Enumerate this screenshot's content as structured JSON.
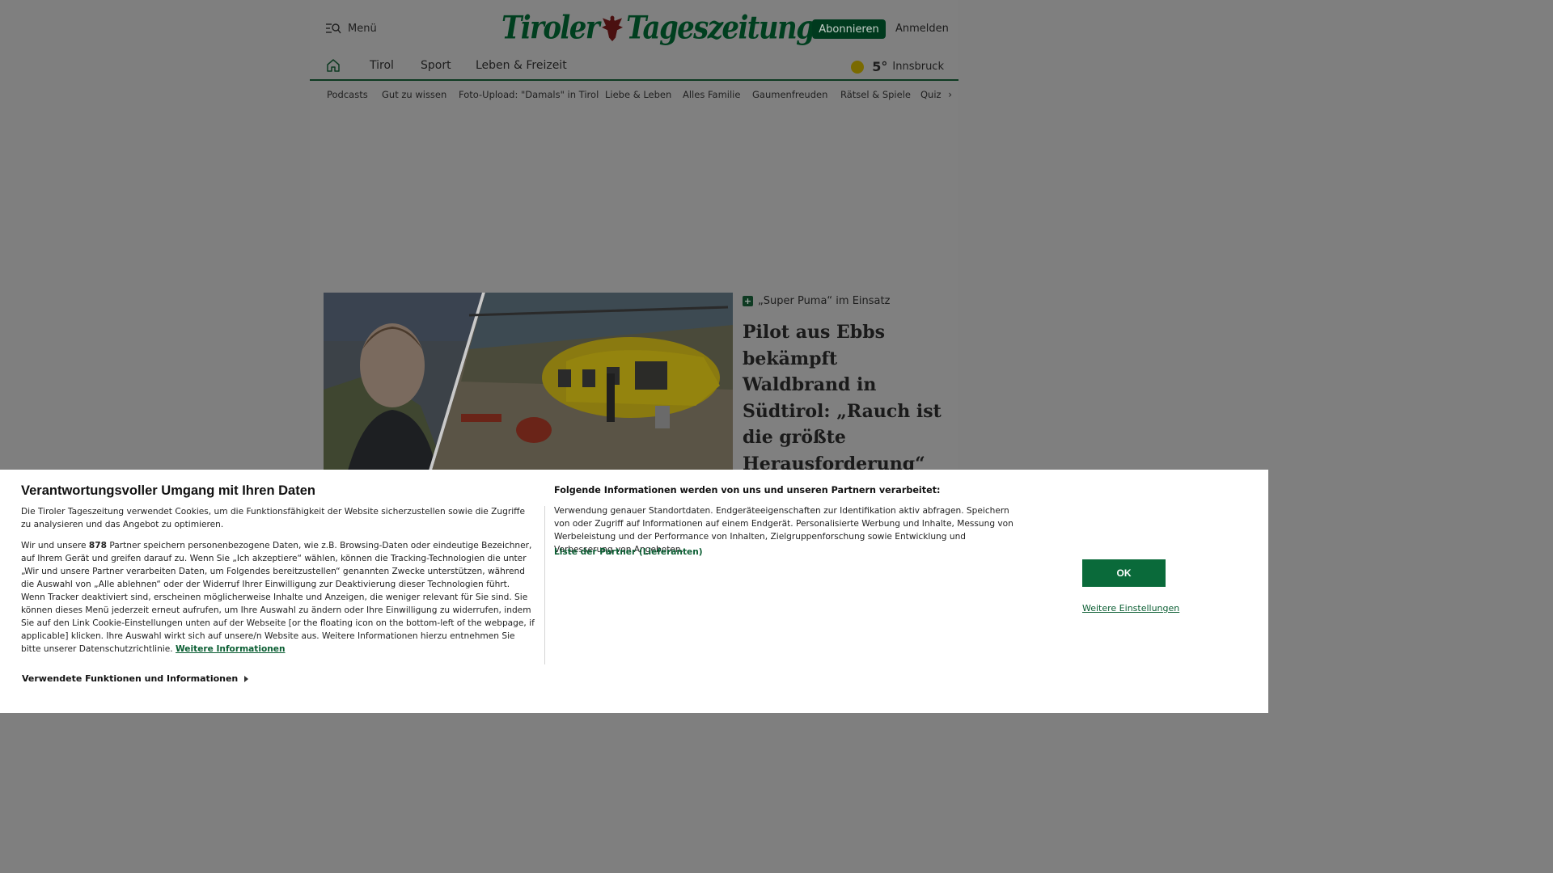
{
  "header": {
    "menu_label": "Menü",
    "logo_left": "Tiroler",
    "logo_right": "Tageszeitung",
    "subscribe_label": "Abonnieren",
    "login_label": "Anmelden"
  },
  "main_nav": {
    "items": [
      "Tirol",
      "Sport",
      "Leben & Freizeit"
    ],
    "weather_temp": "5°",
    "weather_city": "Innsbruck"
  },
  "sub_nav": {
    "items": [
      "Podcasts",
      "Gut zu wissen",
      "Foto-Upload: \"Damals\" in Tirol",
      "Liebe & Leben",
      "Alles Familie",
      "Gaumenfreuden",
      "Rätsel & Spiele",
      "Quiz"
    ]
  },
  "teaser": {
    "kicker": "„Super Puma“ im Einsatz",
    "title": "Pilot aus Ebbs bekämpft Waldbrand in Südtirol: „Rauch ist die größte Herausforderung“"
  },
  "consent": {
    "title": "Verantwortungsvoller Umgang mit Ihren Daten",
    "para1": "Die Tiroler Tageszeitung verwendet Cookies, um die Funktionsfähigkeit der Website sicherzustellen sowie die Zugriffe zu analysieren und das Angebot zu optimieren.",
    "para2_pre": "Wir und unsere ",
    "partner_count": "878",
    "para2_post": " Partner speichern personenbezogene Daten, wie z.B. Browsing-Daten oder eindeutige Bezeichner, auf Ihrem Gerät und greifen darauf zu. Wenn Sie „Ich akzeptiere“ wählen, können die Tracking-Technologien die unter „Wir und unsere Partner verarbeiten Daten, um Folgendes bereitzustellen“ genannten Zwecke unterstützen, während die Auswahl von „Alle ablehnen“ oder der Widerruf Ihrer Einwilligung zur Deaktivierung dieser Technologien führt. Wenn Tracker deaktiviert sind, erscheinen möglicherweise Inhalte und Anzeigen, die weniger relevant für Sie sind. Sie können dieses Menü jederzeit erneut aufrufen, um Ihre Auswahl zu ändern oder Ihre Einwilligung zu widerrufen, indem Sie auf den Link Cookie-Einstellungen unten auf der Webseite [or the floating icon on the bottom-left of the webpage, if applicable] klicken. Ihre Auswahl wirkt sich auf unsere/n Website aus. Weitere Informationen hierzu entnehmen Sie bitte unserer Datenschutzrichtlinie. ",
    "more_info_link": "Weitere Informationen",
    "functions_label": "Verwendete Funktionen und Informationen",
    "right_title": "Folgende Informationen werden von uns und unseren Partnern verarbeitet:",
    "right_text": "Verwendung genauer Standortdaten. Endgeräteeigenschaften zur Identifikation aktiv abfragen. Speichern von oder Zugriff auf Informationen auf einem Endgerät. Personalisierte Werbung und Inhalte, Messung von Werbeleistung und der Performance von Inhalten, Zielgruppenforschung sowie Entwicklung und Verbesserung von Angeboten.",
    "partners_link": "Liste der Partner (Lieferanten)",
    "ok_label": "OK",
    "settings_link": "Weitere Einstellungen"
  },
  "colors": {
    "brand_green": "#0a6a3a",
    "overlay_gray": "#7f7f7f"
  }
}
